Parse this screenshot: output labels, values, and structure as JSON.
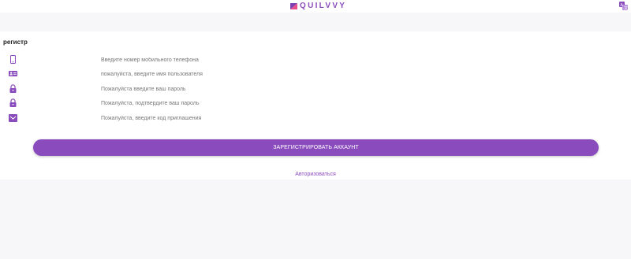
{
  "header": {
    "logo_text": "QUILVVY",
    "logo_icon": "logo-mark-icon",
    "language_icon": "translate-icon"
  },
  "page": {
    "title": "регистр"
  },
  "form": {
    "fields": [
      {
        "icon": "phone-icon",
        "placeholder": "Введите номер мобильного телефона",
        "value": ""
      },
      {
        "icon": "id-card-icon",
        "placeholder": "пожалуйста, введите имя пользователя",
        "value": ""
      },
      {
        "icon": "lock-icon",
        "placeholder": "Пожалуйста введите ваш пароль",
        "value": ""
      },
      {
        "icon": "lock-icon",
        "placeholder": "Пожалуйста, подтвердите ваш пароль",
        "value": ""
      },
      {
        "icon": "envelope-icon",
        "placeholder": "Пожалуйста, введите код приглашения",
        "value": ""
      }
    ],
    "submit_label": "ЗАРЕГИСТРИРОВАТЬ АККАУНТ",
    "login_link": "Авторизоваться"
  },
  "colors": {
    "accent": "#8a4bbd",
    "background": "#f7f7f9",
    "card": "#ffffff"
  }
}
